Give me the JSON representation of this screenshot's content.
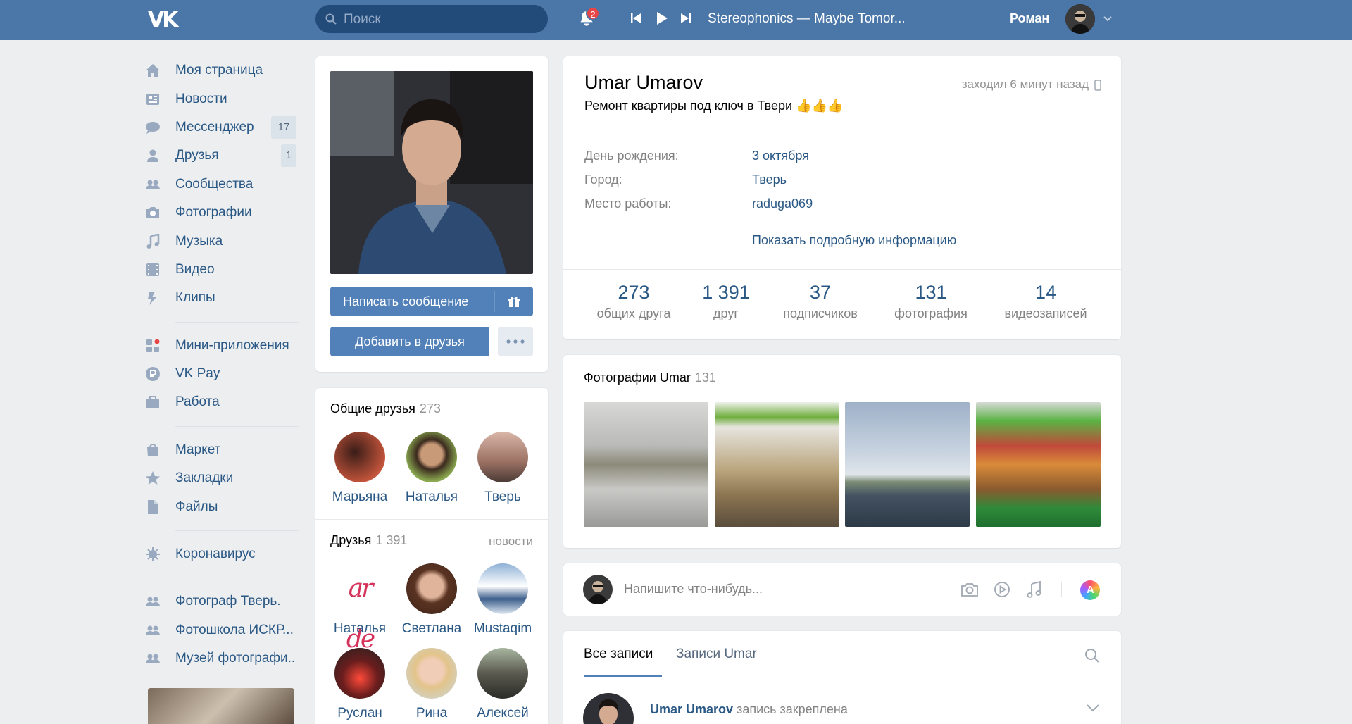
{
  "header": {
    "logo": "VK",
    "search_placeholder": "Поиск",
    "notifications_count": "2",
    "track": "Stereophonics — Maybe Tomor...",
    "user_name": "Роман"
  },
  "sidebar": {
    "items": [
      {
        "label": "Моя страница",
        "icon": "home-icon"
      },
      {
        "label": "Новости",
        "icon": "news-icon"
      },
      {
        "label": "Мессенджер",
        "icon": "messenger-icon",
        "count": "17"
      },
      {
        "label": "Друзья",
        "icon": "friends-icon",
        "count": "1"
      },
      {
        "label": "Сообщества",
        "icon": "communities-icon"
      },
      {
        "label": "Фотографии",
        "icon": "camera-icon"
      },
      {
        "label": "Музыка",
        "icon": "music-icon"
      },
      {
        "label": "Видео",
        "icon": "video-icon"
      },
      {
        "label": "Клипы",
        "icon": "clips-icon"
      }
    ],
    "group2": [
      {
        "label": "Мини-приложения",
        "icon": "apps-icon"
      },
      {
        "label": "VK Pay",
        "icon": "vkpay-icon"
      },
      {
        "label": "Работа",
        "icon": "work-icon"
      }
    ],
    "group3": [
      {
        "label": "Маркет",
        "icon": "market-icon"
      },
      {
        "label": "Закладки",
        "icon": "star-icon"
      },
      {
        "label": "Файлы",
        "icon": "file-icon"
      }
    ],
    "group4": [
      {
        "label": "Коронавирус",
        "icon": "virus-icon"
      }
    ],
    "group5": [
      {
        "label": "Фотограф Тверь.",
        "icon": "group-icon"
      },
      {
        "label": "Фотошкола ИСКР...",
        "icon": "group-icon"
      },
      {
        "label": "Музей фотографи..",
        "icon": "group-icon"
      }
    ]
  },
  "profile": {
    "write_message": "Написать сообщение",
    "add_friend": "Добавить в друзья",
    "name": "Umar Umarov",
    "last_seen": "заходил 6 минут назад",
    "status": "Ремонт квартиры под ключ в Твери 👍👍👍",
    "info": [
      {
        "label": "День рождения:",
        "value": "3 октября"
      },
      {
        "label": "Город:",
        "value": "Тверь"
      },
      {
        "label": "Место работы:",
        "value": "raduga069"
      }
    ],
    "more_info": "Показать подробную информацию",
    "counters": [
      {
        "value": "273",
        "label": "общих друга"
      },
      {
        "value": "1 391",
        "label": "друг"
      },
      {
        "value": "37",
        "label": "подписчиков"
      },
      {
        "value": "131",
        "label": "фотография"
      },
      {
        "value": "14",
        "label": "видеозаписей"
      }
    ]
  },
  "mutual": {
    "title": "Общие друзья",
    "count": "273",
    "people": [
      "Марьяна",
      "Наталья",
      "Тверь"
    ]
  },
  "friends": {
    "title": "Друзья",
    "count": "1 391",
    "link": "новости",
    "people": [
      "Наталья",
      "Светлана",
      "Mustaqim",
      "Руслан",
      "Рина",
      "Алексей"
    ],
    "logo_text": "ar de"
  },
  "photos": {
    "title": "Фотографии Umar",
    "count": "131"
  },
  "composer": {
    "placeholder": "Напишите что-нибудь..."
  },
  "wall": {
    "tab_all": "Все записи",
    "tab_own": "Записи Umar",
    "post_author": "Umar Umarov",
    "post_note": "запись закреплена"
  },
  "colors": {
    "header": "#4a76a8",
    "link": "#2a5885",
    "button": "#5181b8"
  }
}
